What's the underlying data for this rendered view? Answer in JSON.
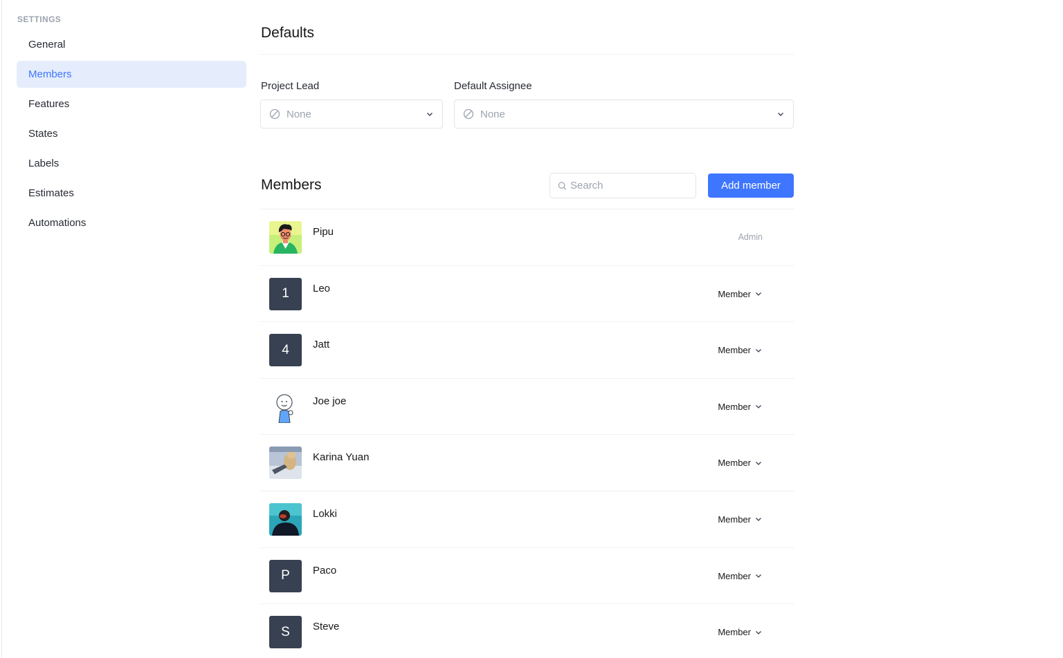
{
  "sidebar": {
    "heading": "SETTINGS",
    "items": [
      {
        "label": "General",
        "active": false
      },
      {
        "label": "Members",
        "active": true
      },
      {
        "label": "Features",
        "active": false
      },
      {
        "label": "States",
        "active": false
      },
      {
        "label": "Labels",
        "active": false
      },
      {
        "label": "Estimates",
        "active": false
      },
      {
        "label": "Automations",
        "active": false
      }
    ]
  },
  "defaults": {
    "title": "Defaults",
    "project_lead": {
      "label": "Project Lead",
      "value": "None",
      "icon": "ban-icon"
    },
    "default_assignee": {
      "label": "Default Assignee",
      "value": "None",
      "icon": "ban-icon"
    }
  },
  "members": {
    "title": "Members",
    "search_placeholder": "Search",
    "add_button": "Add member",
    "list": [
      {
        "name": "Pipu",
        "avatar": "image",
        "role": "Admin",
        "editable": false
      },
      {
        "name": "Leo",
        "avatar": "letter",
        "initial": "1",
        "role": "Member",
        "editable": true
      },
      {
        "name": "Jatt",
        "avatar": "letter",
        "initial": "4",
        "role": "Member",
        "editable": true
      },
      {
        "name": "Joe joe",
        "avatar": "image",
        "role": "Member",
        "editable": true
      },
      {
        "name": "Karina Yuan",
        "avatar": "image",
        "role": "Member",
        "editable": true
      },
      {
        "name": "Lokki",
        "avatar": "image",
        "role": "Member",
        "editable": true
      },
      {
        "name": "Paco",
        "avatar": "letter",
        "initial": "P",
        "role": "Member",
        "editable": true
      },
      {
        "name": "Steve",
        "avatar": "letter",
        "initial": "S",
        "role": "Member",
        "editable": true
      }
    ]
  },
  "colors": {
    "accent": "#3f76ff",
    "active_nav_bg": "#e5edfc",
    "letter_avatar_bg": "#374151"
  }
}
